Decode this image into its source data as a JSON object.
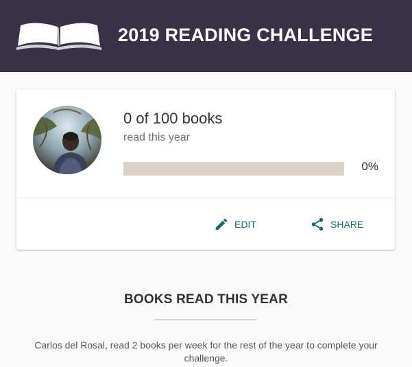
{
  "header": {
    "title": "2019 READING CHALLENGE",
    "icon": "open-book-icon"
  },
  "challenge": {
    "avatar_icon": "user-avatar",
    "count_text": "0 of 100 books",
    "subtitle": "read this year",
    "progress_fraction": 0,
    "percent_text": "0%",
    "track_color": "#d8d3c4"
  },
  "actions": {
    "edit_label": "EDIT",
    "edit_icon": "pencil-icon",
    "share_label": "SHARE",
    "share_icon": "share-icon",
    "color": "#0f6a6e"
  },
  "books_section": {
    "title": "BOOKS READ THIS YEAR",
    "message": "Carlos del Rosal, read 2 books per week for the rest of the year to complete your challenge."
  },
  "colors": {
    "header_bg": "#3a3048"
  }
}
